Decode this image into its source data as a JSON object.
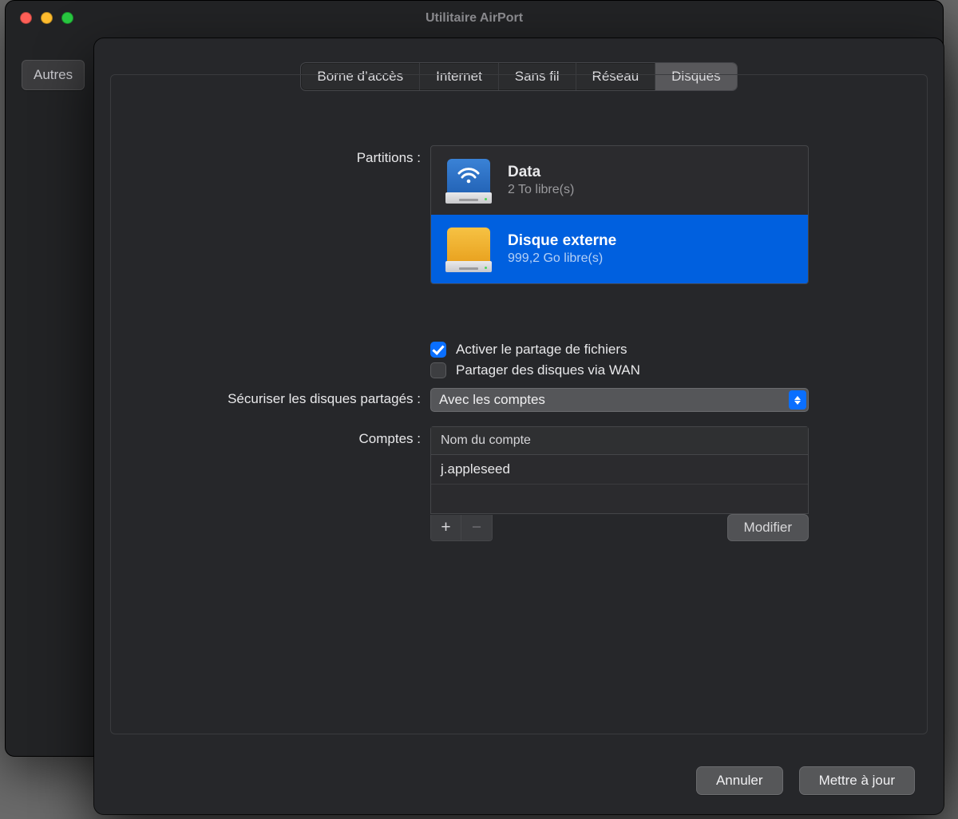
{
  "window": {
    "title": "Utilitaire AirPort",
    "toolbar_other": "Autres"
  },
  "tabs": {
    "items": [
      "Borne d’accès",
      "Internet",
      "Sans fil",
      "Réseau",
      "Disques"
    ],
    "active_index": 4
  },
  "labels": {
    "partitions": "Partitions :",
    "secure_shared_disks": "Sécuriser les disques partagés :",
    "accounts": "Comptes :"
  },
  "partitions": [
    {
      "name": "Data",
      "free": "2 To libre(s)",
      "icon": "airport-disk",
      "selected": false
    },
    {
      "name": "Disque externe",
      "free": "999,2 Go libre(s)",
      "icon": "external-disk",
      "selected": true
    }
  ],
  "checkboxes": {
    "enable_file_sharing": {
      "label": "Activer le partage de fichiers",
      "checked": true
    },
    "share_via_wan": {
      "label": "Partager des disques via WAN",
      "checked": false
    }
  },
  "secure_mode_value": "Avec les comptes",
  "accounts_table": {
    "header": "Nom du compte",
    "rows": [
      "j.appleseed"
    ]
  },
  "buttons": {
    "add": "+",
    "remove": "−",
    "modify": "Modifier",
    "cancel": "Annuler",
    "update": "Mettre à jour"
  }
}
